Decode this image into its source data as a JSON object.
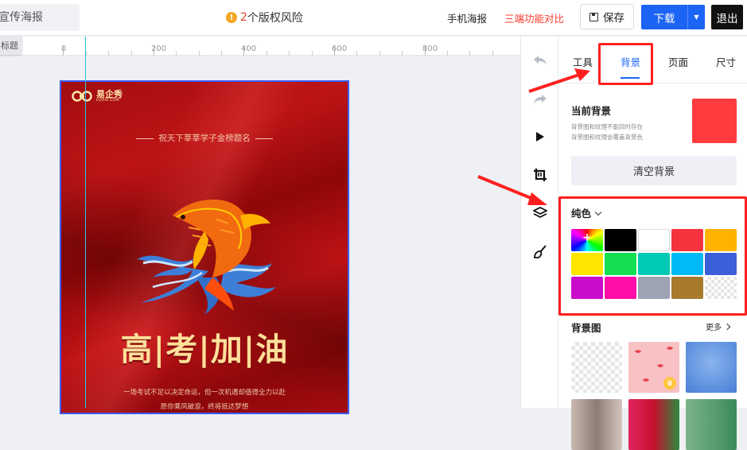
{
  "header": {
    "title_value": "宣传海报",
    "risk_count": "2",
    "risk_text": "个版权风险",
    "links": {
      "mobile_poster": "手机海报",
      "compare": "三端功能对比"
    },
    "save_label": "保存",
    "download_label": "下载",
    "exit_label": "退出"
  },
  "ruler": {
    "labels": [
      "0",
      "200",
      "400",
      "600",
      "800"
    ]
  },
  "canvas_chip": "标题",
  "poster": {
    "logo_name": "易企秀",
    "logo_sub": "EQXIU.COM",
    "motto": "祝天下莘莘学子金榜题名",
    "headline": "高|考|加|油",
    "body_line1": "一场考试不足以决定命运，但一次机遇却值得全力以赴",
    "body_line2": "愿你乘风破浪，终将抵达梦想"
  },
  "panel": {
    "tabs": [
      "工具",
      "背景",
      "页面",
      "尺寸"
    ],
    "active_tab": "背景",
    "current_bg_title": "当前背景",
    "current_bg_note1": "背景图和纹理不能同时存在",
    "current_bg_note2": "背景图和纹理会覆盖背景色",
    "current_bg_color": "#ff3b3f",
    "clear_label": "清空背景",
    "solid_label": "纯色",
    "swatches": [
      "picker",
      "#000000",
      "#ffffff",
      "#f5333f",
      "#ffb300",
      "#ffe600",
      "#14de52",
      "#00c9b5",
      "#00b9f5",
      "#3b5fd9",
      "#c90cc9",
      "#ff0fa8",
      "#9da3b3",
      "#a87a2e",
      "transparent"
    ],
    "bg_image_label": "背景图",
    "more_label": "更多"
  },
  "colors": {
    "accent": "#1b64f5",
    "annotation": "#ff1f1f"
  }
}
